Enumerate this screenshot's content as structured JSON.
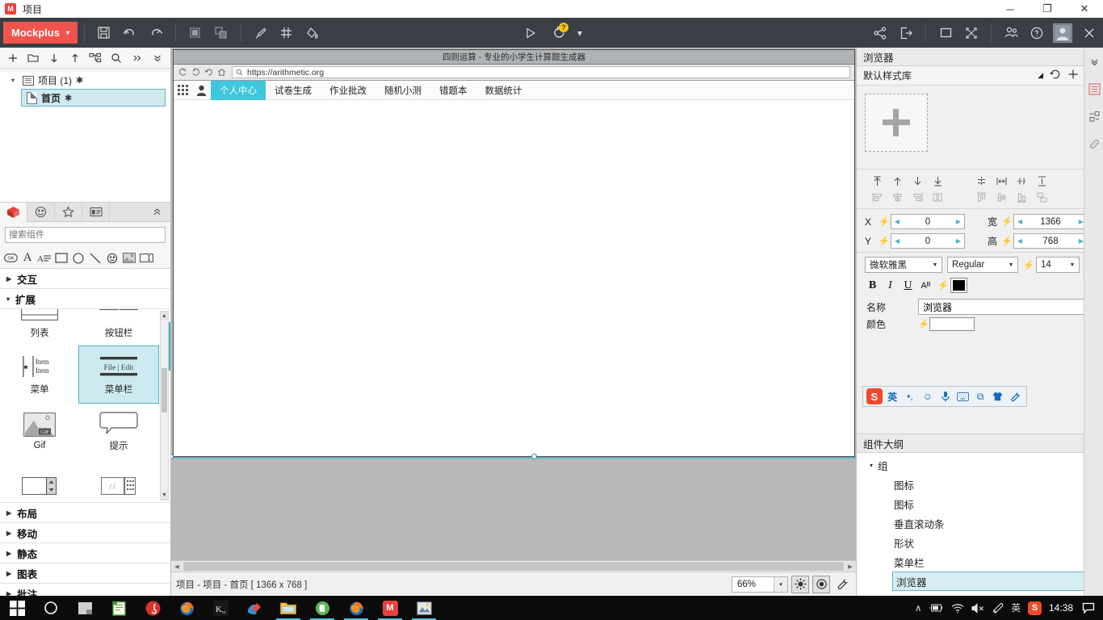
{
  "window": {
    "title": "项目",
    "app_badge": "M",
    "minimize": "─",
    "maximize": "❐",
    "close": "✕"
  },
  "toolbar": {
    "brand": "Mockplus",
    "brand_caret": "▾",
    "icons": {
      "save": "save-icon",
      "undo": "undo-icon",
      "redo": "redo-icon",
      "group": "group-icon",
      "ungroup": "ungroup-icon",
      "brush": "brush-icon",
      "grid": "grid-icon",
      "fill": "fill-icon",
      "preview": "preview-play-icon",
      "sync": "sync-icon",
      "sync_badge": "?",
      "sync_caret": "▾",
      "share": "share-icon",
      "export": "export-icon",
      "window": "window-icon",
      "fullscreen": "fullscreen-icon",
      "team": "team-icon",
      "help": "help-icon",
      "account": "account-avatar"
    }
  },
  "project_tree": {
    "tools": [
      "add",
      "folder",
      "down",
      "up",
      "sitemap",
      "search",
      "more",
      "collapse"
    ],
    "root": {
      "label": "项目 (1)",
      "modified": "✱"
    },
    "child": {
      "label": "首页",
      "modified": "✱"
    }
  },
  "library": {
    "tabs": [
      "components-tab",
      "icons-tab",
      "favorites-tab",
      "my-tab"
    ],
    "search_placeholder": "搜索组件",
    "quick_icons": [
      "ok-button-icon",
      "text-icon",
      "paragraph-icon",
      "rect-icon",
      "circle-icon",
      "line-icon",
      "emoji-icon",
      "image-icon",
      "input-icon"
    ],
    "sections": [
      {
        "label": "交互",
        "expanded": false
      },
      {
        "label": "扩展",
        "expanded": true
      },
      {
        "label": "布局",
        "expanded": false
      },
      {
        "label": "移动",
        "expanded": false
      },
      {
        "label": "静态",
        "expanded": false
      },
      {
        "label": "图表",
        "expanded": false
      },
      {
        "label": "批注",
        "expanded": false
      }
    ],
    "items": [
      {
        "label": "列表",
        "selected": false
      },
      {
        "label": "按钮栏",
        "selected": false
      },
      {
        "label": "菜单",
        "selected": false
      },
      {
        "label": "菜单栏",
        "selected": true,
        "thumb_text": "File | Edit"
      },
      {
        "label": "Gif",
        "selected": false,
        "thumb_text": "GIF"
      },
      {
        "label": "提示",
        "selected": false
      },
      {
        "label": "",
        "selected": false
      },
      {
        "label": "",
        "selected": false
      }
    ],
    "menu_items_thumb": [
      "Item",
      "Item"
    ]
  },
  "canvas": {
    "browser": {
      "title": "四则运算 - 专业的小学生计算题生成器",
      "nav": [
        "back-icon",
        "forward-icon",
        "reload-icon",
        "home-icon"
      ],
      "url": "https://arithmetic.org",
      "url_icon": "search-icon",
      "menu": [
        {
          "label": "个人中心",
          "active": true
        },
        {
          "label": "试卷生成",
          "active": false
        },
        {
          "label": "作业批改",
          "active": false
        },
        {
          "label": "随机小测",
          "active": false
        },
        {
          "label": "错题本",
          "active": false
        },
        {
          "label": "数据统计",
          "active": false
        }
      ],
      "accent": "#3ec7dd"
    }
  },
  "statusbar": {
    "path": "项目 - 项目 - 首页 [ 1366 x 768 ]",
    "zoom": "66%",
    "zoom_caret": "▾",
    "buttons": [
      "brightness-icon",
      "eye-icon",
      "wrench-icon"
    ]
  },
  "properties": {
    "panel_title": "浏览器",
    "panel_collapse": "»",
    "style_library": "默认样式库",
    "style_caret": "◢",
    "style_icons": [
      "refresh-icon",
      "add-icon",
      "settings-icon"
    ],
    "geometry": [
      {
        "label": "X",
        "value": "0"
      },
      {
        "label": "宽",
        "value": "1366"
      },
      {
        "label": "Y",
        "value": "0"
      },
      {
        "label": "高",
        "value": "768"
      }
    ],
    "font_family": "微软雅黑",
    "font_weight": "Regular",
    "font_size": "14",
    "text_styles": [
      "B",
      "I",
      "U",
      "Aᴮ"
    ],
    "text_color": "#000000",
    "name_label": "名称",
    "name_value": "浏览器",
    "color_label": "颜色"
  },
  "ime": {
    "logo": "S",
    "items": [
      "英",
      "•,",
      "☺",
      "ᴘ",
      "⌨",
      "⧉",
      "☘",
      "⚒"
    ]
  },
  "outline": {
    "title": "组件大纲",
    "collapse": "«",
    "root": "组",
    "items": [
      {
        "label": "图标",
        "selected": false
      },
      {
        "label": "图标",
        "selected": false
      },
      {
        "label": "垂直滚动条",
        "selected": false
      },
      {
        "label": "形状",
        "selected": false
      },
      {
        "label": "菜单栏",
        "selected": false
      },
      {
        "label": "浏览器",
        "selected": true
      }
    ]
  },
  "taskbar": {
    "apps": [
      {
        "name": "start-button",
        "glyph": "⊞",
        "color": "#0b0b0b",
        "text": "#ffffff",
        "open": false
      },
      {
        "name": "cortana-search",
        "glyph": "○",
        "color": "#0b0b0b",
        "text": "#ffffff",
        "open": false
      },
      {
        "name": "task-view",
        "glyph": "◰",
        "color": "#0b0b0b",
        "text": "#dddddd",
        "open": false
      },
      {
        "name": "notepad-app",
        "glyph": "✎",
        "color": "#3f9b3f",
        "text": "#ffffff",
        "open": false
      },
      {
        "name": "netease-music-app",
        "glyph": "♪",
        "color": "#d8322c",
        "text": "#ffffff",
        "open": false
      },
      {
        "name": "firefox-app",
        "glyph": "●",
        "color": "#e36b1d",
        "text": "#ffffff",
        "open": false
      },
      {
        "name": "kingsoft-app",
        "glyph": "K",
        "color": "#2c2c2c",
        "text": "#eeeeee",
        "open": false
      },
      {
        "name": "paint-app",
        "glyph": "✏",
        "color": "#2a6fb5",
        "text": "#ffffff",
        "open": false
      },
      {
        "name": "explorer-app",
        "glyph": "☰",
        "color": "#e8b84b",
        "text": "#6a4a00",
        "open": true
      },
      {
        "name": "evernote-app",
        "glyph": "●",
        "color": "#5ab553",
        "text": "#ffffff",
        "open": true
      },
      {
        "name": "firefox-app-2",
        "glyph": "●",
        "color": "#e36b1d",
        "text": "#ffffff",
        "open": true
      },
      {
        "name": "mockplus-app",
        "glyph": "M",
        "color": "#e8413e",
        "text": "#ffffff",
        "open": true
      },
      {
        "name": "screenshot-app",
        "glyph": "▣",
        "color": "#6f8aa5",
        "text": "#ffffff",
        "open": true
      }
    ],
    "tray": {
      "chevron": "∧",
      "battery": "battery-icon",
      "wifi": "wifi-icon",
      "volume": "volume-mute-icon",
      "pen": "pen-icon",
      "lang": "英",
      "ime": "S",
      "clock": "14:38",
      "notifications": "notification-icon"
    }
  }
}
